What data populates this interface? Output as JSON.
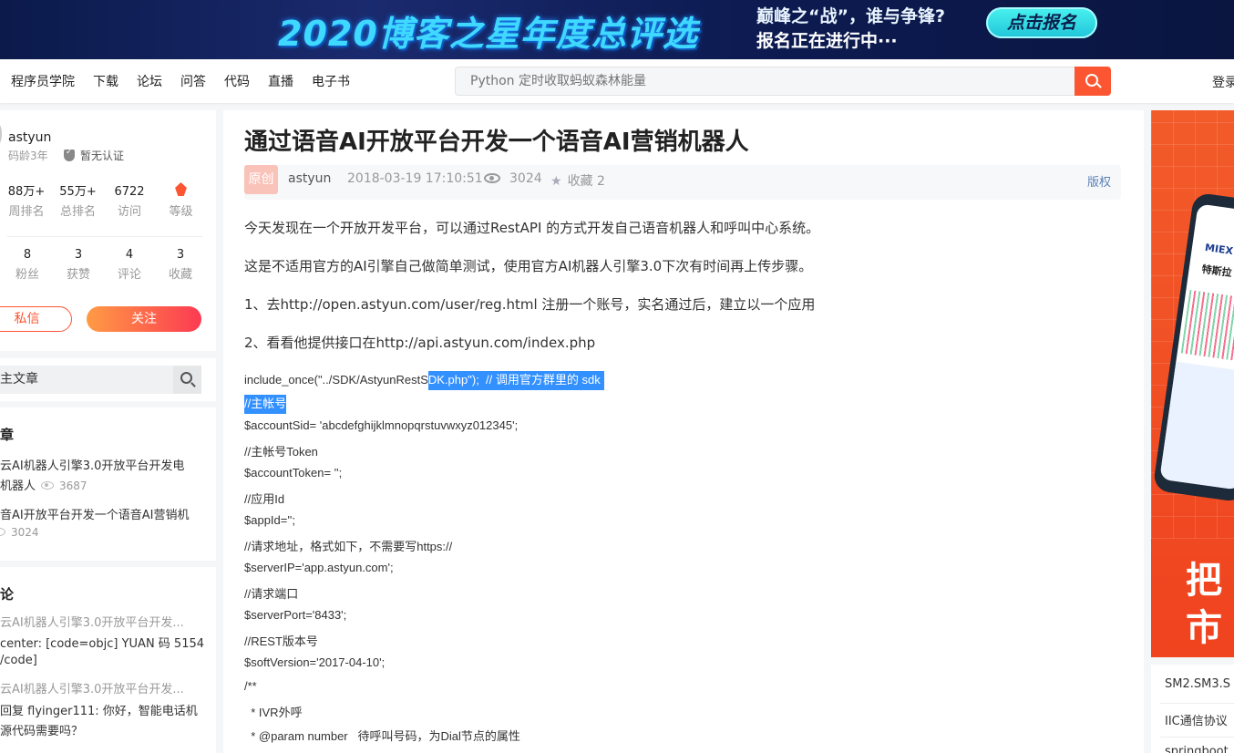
{
  "banner": {
    "title": "2020博客之星年度总评选",
    "slogan_line1": "巅峰之“战”，谁与争锋?",
    "slogan_line2": "报名正在进行中···",
    "cta": "点击报名"
  },
  "topnav": {
    "items": [
      "程序员学院",
      "下载",
      "论坛",
      "问答",
      "代码",
      "直播",
      "电子书"
    ],
    "search_placeholder": "Python 定时收取蚂蚁森林能量",
    "login": "登录"
  },
  "profile": {
    "username": "astyun",
    "age": "码龄3年",
    "cert": "暂无认证",
    "stats_row1": [
      {
        "value": "88万+",
        "label": "周排名"
      },
      {
        "value": "55万+",
        "label": "总排名"
      },
      {
        "value": "6722",
        "label": "访问"
      },
      {
        "value": "",
        "label": "等级"
      }
    ],
    "stats_row2": [
      {
        "value": "8",
        "label": "粉丝"
      },
      {
        "value": "3",
        "label": "获赞"
      },
      {
        "value": "4",
        "label": "评论"
      },
      {
        "value": "3",
        "label": "收藏"
      }
    ],
    "msg_button": "私信",
    "follow_button": "关注"
  },
  "sidebar_search": {
    "placeholder": "主文章"
  },
  "recent": {
    "title": "章",
    "articles": [
      {
        "line1": "云AI机器人引擎3.0开放平台开发电",
        "line2": "机器人",
        "views": "3687"
      },
      {
        "line1": "音AI开放平台开发一个语音AI营销机",
        "views": "3024"
      }
    ]
  },
  "comments": {
    "title": "论",
    "items": [
      {
        "article": "云AI机器人引擎3.0开放平台开发...",
        "text1": "center: [code=objc] YUAN 码 5154",
        "text2": "/code]"
      },
      {
        "article": "云AI机器人引擎3.0开放平台开发...",
        "text1": "回复 flyinger111: 你好，智能电话机",
        "text2": "源代码需要吗？"
      }
    ]
  },
  "article": {
    "title": "通过语音AI开放平台开发一个语音AI营销机器人",
    "tag": "原创",
    "author": "astyun",
    "date": "2018-03-19 17:10:51",
    "views": "3024",
    "favorites": "收藏 2",
    "copyright": "版权",
    "paragraphs": [
      "今天发现在一个开放开发平台，可以通过RestAPI 的方式开发自己语音机器人和呼叫中心系统。",
      "这是不适用官方的AI引擎自己做简单测试，使用官方AI机器人引擎3.0下次有时间再上传步骤。",
      "1、去http://open.astyun.com/user/reg.html 注册一个账号，实名通过后，建立以一个应用",
      "2、看看他提供接口在http://api.astyun.com/index.php"
    ],
    "code_first_plain": "include_once(\"../SDK/AstyunRestS",
    "code_first_selected": "DK.php\");  // 调用官方群里的 sdk",
    "code_second_selected": "//主帐号",
    "code_lines": [
      "$accountSid= 'abcdefghijklmnopqrstuvwxyz012345';",
      "//主帐号Token",
      "$accountToken= '';",
      "//应用Id",
      "$appId='';",
      "//请求地址，格式如下，不需要写https://",
      "$serverIP='app.astyun.com';",
      "//请求端口",
      "$serverPort='8433';",
      "//REST版本号",
      "$softVersion='2017-04-10';",
      "/**",
      "  * IVR外呼",
      "  * @param number   待呼叫号码，为Dial节点的属性"
    ]
  },
  "ad": {
    "phone_logo": "MIEX",
    "phone_stock": "特斯拉",
    "big_text_line1": "把",
    "big_text_line2": "市"
  },
  "right_list": [
    "SM2.SM3.S",
    "IIC通信协议",
    "springboot"
  ]
}
